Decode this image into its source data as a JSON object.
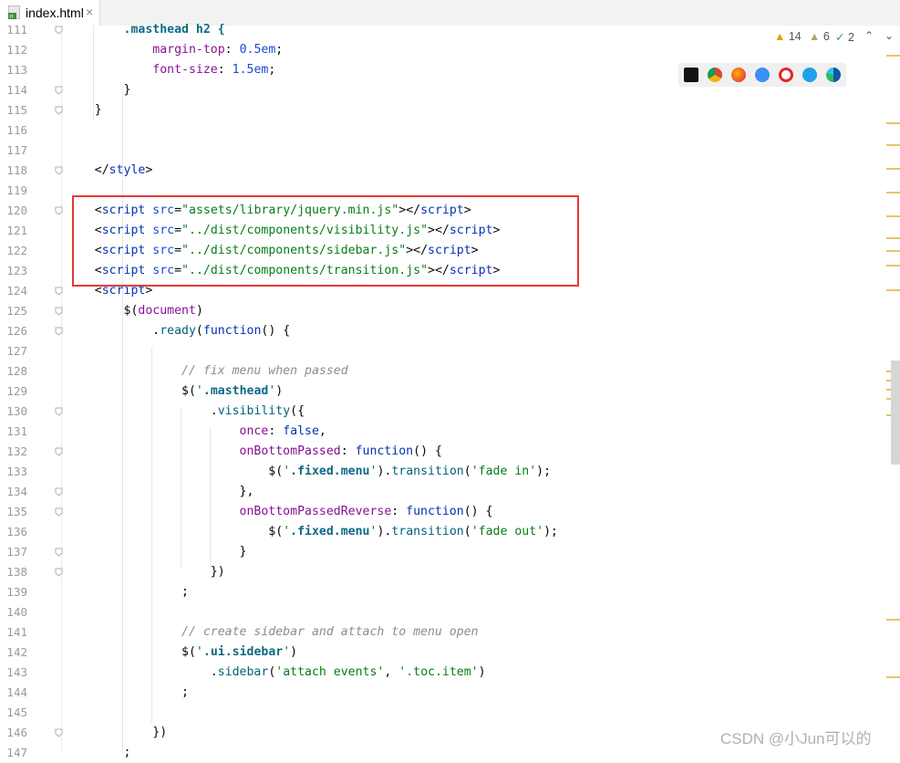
{
  "tab": {
    "filename": "index.html",
    "close": "×"
  },
  "inspections": {
    "warnings": "14",
    "weak_warnings": "6",
    "typos": "2",
    "up": "⌃",
    "down": "⌄"
  },
  "browsers": [
    "intellij-icon",
    "chrome-icon",
    "firefox-icon",
    "safari-icon",
    "opera-icon",
    "ie-icon",
    "edge-icon"
  ],
  "lines": [
    {
      "n": "111",
      "code": [
        {
          "c": "sel",
          "t": "        .masthead h2 {"
        }
      ]
    },
    {
      "n": "112",
      "code": [
        {
          "c": "prop",
          "t": "            margin-top"
        },
        {
          "c": "",
          "t": ": "
        },
        {
          "c": "a",
          "t": "0.5em"
        },
        {
          "c": "",
          "t": ";"
        }
      ]
    },
    {
      "n": "113",
      "code": [
        {
          "c": "prop",
          "t": "            font-size"
        },
        {
          "c": "",
          "t": ": "
        },
        {
          "c": "a",
          "t": "1.5em"
        },
        {
          "c": "",
          "t": ";"
        }
      ]
    },
    {
      "n": "114",
      "code": [
        {
          "c": "",
          "t": "        }"
        }
      ]
    },
    {
      "n": "115",
      "code": [
        {
          "c": "",
          "t": "    }"
        }
      ]
    },
    {
      "n": "116",
      "code": []
    },
    {
      "n": "117",
      "code": []
    },
    {
      "n": "118",
      "code": [
        {
          "c": "",
          "t": "    </"
        },
        {
          "c": "t",
          "t": "style"
        },
        {
          "c": "",
          "t": ">"
        }
      ]
    },
    {
      "n": "119",
      "code": []
    },
    {
      "n": "120",
      "code": [
        {
          "c": "",
          "t": "    <"
        },
        {
          "c": "t",
          "t": "script "
        },
        {
          "c": "a",
          "t": "src"
        },
        {
          "c": "",
          "t": "="
        },
        {
          "c": "s",
          "t": "\"assets/library/jquery.min.js\""
        },
        {
          "c": "",
          "t": "></"
        },
        {
          "c": "t",
          "t": "script"
        },
        {
          "c": "",
          "t": ">"
        }
      ]
    },
    {
      "n": "121",
      "code": [
        {
          "c": "",
          "t": "    <"
        },
        {
          "c": "t",
          "t": "script "
        },
        {
          "c": "a",
          "t": "src"
        },
        {
          "c": "",
          "t": "="
        },
        {
          "c": "s",
          "t": "\"../dist/components/visibility.js\""
        },
        {
          "c": "",
          "t": "></"
        },
        {
          "c": "t",
          "t": "script"
        },
        {
          "c": "",
          "t": ">"
        }
      ]
    },
    {
      "n": "122",
      "code": [
        {
          "c": "",
          "t": "    <"
        },
        {
          "c": "t",
          "t": "script "
        },
        {
          "c": "a",
          "t": "src"
        },
        {
          "c": "",
          "t": "="
        },
        {
          "c": "s",
          "t": "\"../dist/components/sidebar.js\""
        },
        {
          "c": "",
          "t": "></"
        },
        {
          "c": "t",
          "t": "script"
        },
        {
          "c": "",
          "t": ">"
        }
      ]
    },
    {
      "n": "123",
      "code": [
        {
          "c": "",
          "t": "    <"
        },
        {
          "c": "t",
          "t": "script "
        },
        {
          "c": "a",
          "t": "src"
        },
        {
          "c": "",
          "t": "="
        },
        {
          "c": "s",
          "t": "\"../dist/components/transition.js\""
        },
        {
          "c": "",
          "t": "></"
        },
        {
          "c": "t",
          "t": "script"
        },
        {
          "c": "",
          "t": ">"
        }
      ]
    },
    {
      "n": "124",
      "code": [
        {
          "c": "",
          "t": "    <"
        },
        {
          "c": "t",
          "t": "script"
        },
        {
          "c": "",
          "t": ">"
        }
      ]
    },
    {
      "n": "125",
      "code": [
        {
          "c": "",
          "t": "        $("
        },
        {
          "c": "p",
          "t": "document"
        },
        {
          "c": "",
          "t": ")"
        }
      ]
    },
    {
      "n": "126",
      "code": [
        {
          "c": "",
          "t": "            ."
        },
        {
          "c": "jq",
          "t": "ready"
        },
        {
          "c": "",
          "t": "("
        },
        {
          "c": "k",
          "t": "function"
        },
        {
          "c": "",
          "t": "() {"
        }
      ]
    },
    {
      "n": "127",
      "code": []
    },
    {
      "n": "128",
      "code": [
        {
          "c": "c",
          "t": "                // fix menu when passed"
        }
      ]
    },
    {
      "n": "129",
      "code": [
        {
          "c": "",
          "t": "                $("
        },
        {
          "c": "s",
          "t": "'"
        },
        {
          "c": "sel",
          "t": ".masthead"
        },
        {
          "c": "s",
          "t": "'"
        },
        {
          "c": "",
          "t": ")"
        }
      ]
    },
    {
      "n": "130",
      "code": [
        {
          "c": "",
          "t": "                    ."
        },
        {
          "c": "jq",
          "t": "visibility"
        },
        {
          "c": "",
          "t": "({"
        }
      ]
    },
    {
      "n": "131",
      "code": [
        {
          "c": "prop",
          "t": "                        once"
        },
        {
          "c": "",
          "t": ": "
        },
        {
          "c": "k",
          "t": "false"
        },
        {
          "c": "",
          "t": ","
        }
      ]
    },
    {
      "n": "132",
      "code": [
        {
          "c": "prop",
          "t": "                        onBottomPassed"
        },
        {
          "c": "",
          "t": ": "
        },
        {
          "c": "k",
          "t": "function"
        },
        {
          "c": "",
          "t": "() {"
        }
      ]
    },
    {
      "n": "133",
      "code": [
        {
          "c": "",
          "t": "                            $("
        },
        {
          "c": "s",
          "t": "'"
        },
        {
          "c": "sel",
          "t": ".fixed.menu"
        },
        {
          "c": "s",
          "t": "'"
        },
        {
          "c": "",
          "t": ")."
        },
        {
          "c": "jq",
          "t": "transition"
        },
        {
          "c": "",
          "t": "("
        },
        {
          "c": "s",
          "t": "'fade in'"
        },
        {
          "c": "",
          "t": ");"
        }
      ]
    },
    {
      "n": "134",
      "code": [
        {
          "c": "",
          "t": "                        },"
        }
      ]
    },
    {
      "n": "135",
      "code": [
        {
          "c": "prop",
          "t": "                        onBottomPassedReverse"
        },
        {
          "c": "",
          "t": ": "
        },
        {
          "c": "k",
          "t": "function"
        },
        {
          "c": "",
          "t": "() {"
        }
      ]
    },
    {
      "n": "136",
      "code": [
        {
          "c": "",
          "t": "                            $("
        },
        {
          "c": "s",
          "t": "'"
        },
        {
          "c": "sel",
          "t": ".fixed.menu"
        },
        {
          "c": "s",
          "t": "'"
        },
        {
          "c": "",
          "t": ")."
        },
        {
          "c": "jq",
          "t": "transition"
        },
        {
          "c": "",
          "t": "("
        },
        {
          "c": "s",
          "t": "'fade out'"
        },
        {
          "c": "",
          "t": ");"
        }
      ]
    },
    {
      "n": "137",
      "code": [
        {
          "c": "",
          "t": "                        }"
        }
      ]
    },
    {
      "n": "138",
      "code": [
        {
          "c": "",
          "t": "                    })"
        }
      ]
    },
    {
      "n": "139",
      "code": [
        {
          "c": "",
          "t": "                ;"
        }
      ]
    },
    {
      "n": "140",
      "code": []
    },
    {
      "n": "141",
      "code": [
        {
          "c": "c",
          "t": "                // create sidebar and attach to menu open"
        }
      ]
    },
    {
      "n": "142",
      "code": [
        {
          "c": "",
          "t": "                $("
        },
        {
          "c": "s",
          "t": "'"
        },
        {
          "c": "sel",
          "t": ".ui.sidebar"
        },
        {
          "c": "s",
          "t": "'"
        },
        {
          "c": "",
          "t": ")"
        }
      ]
    },
    {
      "n": "143",
      "code": [
        {
          "c": "",
          "t": "                    ."
        },
        {
          "c": "jq",
          "t": "sidebar"
        },
        {
          "c": "",
          "t": "("
        },
        {
          "c": "s",
          "t": "'attach events'"
        },
        {
          "c": "",
          "t": ", "
        },
        {
          "c": "s",
          "t": "'.toc.item'"
        },
        {
          "c": "",
          "t": ")"
        }
      ]
    },
    {
      "n": "144",
      "code": [
        {
          "c": "",
          "t": "                ;"
        }
      ]
    },
    {
      "n": "145",
      "code": []
    },
    {
      "n": "146",
      "code": [
        {
          "c": "",
          "t": "            })"
        }
      ]
    },
    {
      "n": "147",
      "code": [
        {
          "c": "",
          "t": "        ;"
        }
      ]
    }
  ],
  "watermark": "CSDN @小Jun可以的"
}
